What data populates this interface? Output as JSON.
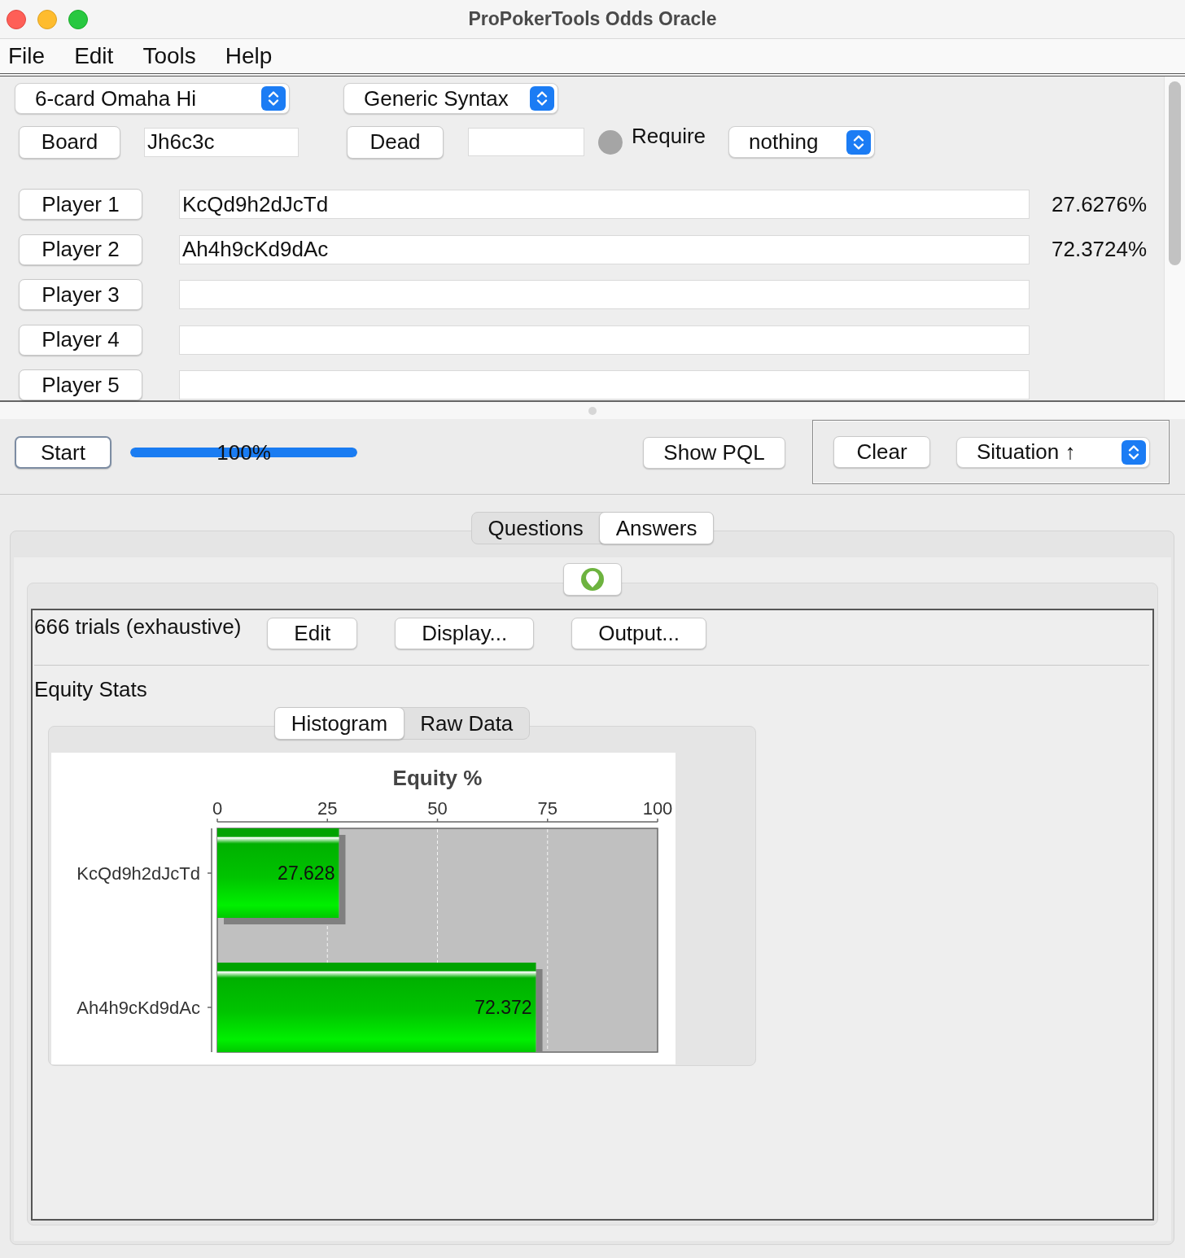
{
  "window": {
    "title": "ProPokerTools Odds Oracle"
  },
  "menu_bar": [
    "File",
    "Edit",
    "Tools",
    "Help"
  ],
  "setup": {
    "game": "6-card Omaha Hi",
    "syntax": "Generic Syntax",
    "board_button": "Board",
    "board": "Jh6c3c",
    "dead_button": "Dead",
    "require": {
      "label": "Require",
      "checked": false
    },
    "require_value": "nothing"
  },
  "players": [
    {
      "button": "Player 1",
      "hand": "KcQd9h2dJcTd",
      "equity": "27.6276%"
    },
    {
      "button": "Player 2",
      "hand": "Ah4h9cKd9dAc",
      "equity": "72.3724%"
    },
    {
      "button": "Player 3"
    },
    {
      "button": "Player 4"
    },
    {
      "button": "Player 5"
    }
  ],
  "controls": {
    "start_button": "Start",
    "progress": {
      "level": 1,
      "reading": "100%"
    },
    "show_pql_button": "Show PQL",
    "clear_button": "Clear",
    "sort": "Situation ↑"
  },
  "result_tabs": [
    {
      "label": "Questions",
      "selected": false
    },
    {
      "label": "Answers",
      "selected": true
    }
  ],
  "answers": {
    "summary": "666 trials (exhaustive)",
    "buttons": [
      "Edit",
      "Display...",
      "Output..."
    ],
    "section_title": "Equity Stats",
    "view_tabs": [
      {
        "label": "Histogram",
        "selected": true
      },
      {
        "label": "Raw Data",
        "selected": false
      }
    ],
    "chart_data": {
      "type": "bar",
      "orientation": "horizontal",
      "title": "Equity %",
      "categories": [
        "KcQd9h2dJcTd",
        "Ah4h9cKd9dAc"
      ],
      "values": [
        27.628,
        72.372
      ],
      "xlim": [
        0,
        100
      ],
      "xticks": [
        0,
        25,
        50,
        75,
        100
      ],
      "grid": true,
      "data_labels": true
    }
  }
}
